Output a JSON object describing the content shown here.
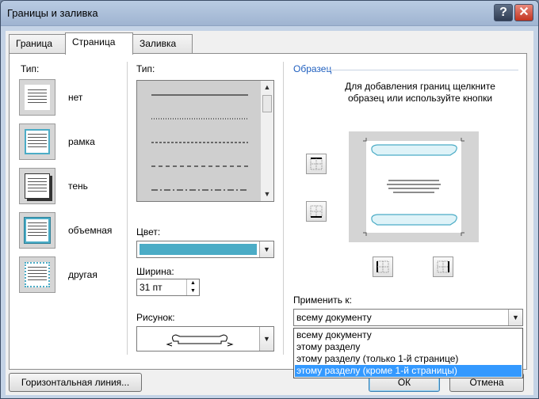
{
  "window": {
    "title": "Границы и заливка",
    "help_label": "?",
    "close_label": "✕"
  },
  "tabs": [
    {
      "label": "Граница",
      "active": false
    },
    {
      "label": "Страница",
      "active": true
    },
    {
      "label": "Заливка",
      "active": false
    }
  ],
  "setting": {
    "label": "Тип:",
    "presets": [
      {
        "label": "нет",
        "icon": "no-border-icon"
      },
      {
        "label": "рамка",
        "icon": "box-border-icon"
      },
      {
        "label": "тень",
        "icon": "shadow-border-icon"
      },
      {
        "label": "объемная",
        "icon": "3d-border-icon"
      },
      {
        "label": "другая",
        "icon": "custom-border-icon"
      }
    ]
  },
  "style": {
    "label": "Тип:",
    "lines": [
      "solid",
      "dotted",
      "dashed-small",
      "dashed",
      "dash-dot"
    ],
    "color_label": "Цвет:",
    "color_value": "#4bacc6",
    "width_label": "Ширина:",
    "width_value": "31 пт",
    "art_label": "Рисунок:"
  },
  "preview": {
    "heading": "Образец",
    "instruction": "Для добавления границ щелкните образец или используйте кнопки",
    "apply_label": "Применить к:",
    "apply_value": "всему документу",
    "apply_options": [
      "всему документу",
      "этому разделу",
      "этому разделу (только 1-й странице)",
      "этому разделу (кроме 1-й страницы)"
    ],
    "highlighted_option": "этому разделу (кроме 1-й страницы)"
  },
  "buttons": {
    "horizontal_line": "Горизонтальная линия...",
    "ok": "ОК",
    "cancel": "Отмена"
  },
  "colors": {
    "accent": "#4bacc6",
    "selection": "#3399ff",
    "titlebar": "#b9cbe2",
    "link": "#1f5fbf"
  }
}
